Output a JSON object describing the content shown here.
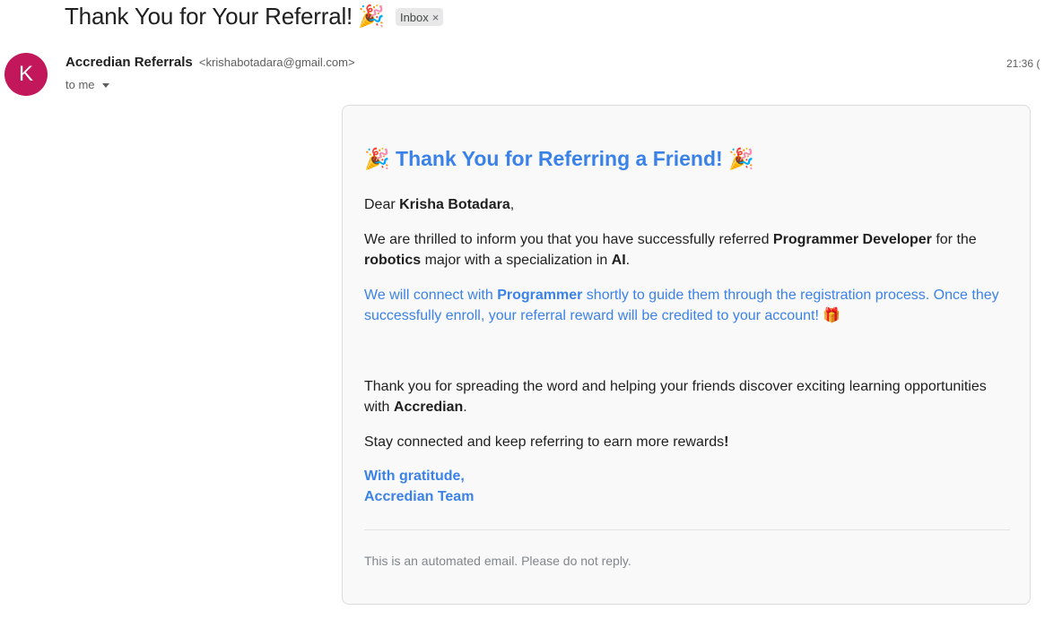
{
  "email": {
    "subject": "Thank You for Your Referral!",
    "subject_emoji": "🎉",
    "label": "Inbox",
    "label_close": "×",
    "sender": {
      "avatar_letter": "K",
      "avatar_color": "#c2185b",
      "name": "Accredian Referrals",
      "email": "<krishabotadara@gmail.com>"
    },
    "recipient": "to me",
    "timestamp": "21:36 (",
    "body": {
      "accent_color": "#3b82e8",
      "title_emoji_left": "🎉",
      "title": "Thank You for Referring a Friend!",
      "title_emoji_right": "🎉",
      "greeting_prefix": "Dear ",
      "recipient_name": "Krisha Botadara",
      "greeting_suffix": ",",
      "para1_part1": "We are thrilled to inform you that you have successfully referred ",
      "referee_full": "Programmer Developer",
      "para1_part2": " for the ",
      "major": "robotics",
      "para1_part3": " major with a specialization in ",
      "specialization": "AI",
      "para1_part4": ".",
      "para2_part1": "We will connect with ",
      "referee_first": "Programmer",
      "para2_part2": " shortly to guide them through the registration process. Once they successfully enroll, your referral reward will be credited to your account! ",
      "gift_emoji": "🎁",
      "para3_part1": "Thank you for spreading the word and helping your friends discover exciting learning opportunities with ",
      "company": "Accredian",
      "para3_part2": ".",
      "para4_part1": "Stay connected and keep referring to earn more rewards",
      "para4_bang": "!",
      "signoff_line1": "With gratitude,",
      "signoff_line2": "Accredian Team",
      "footer": "This is an automated email. Please do not reply."
    }
  }
}
